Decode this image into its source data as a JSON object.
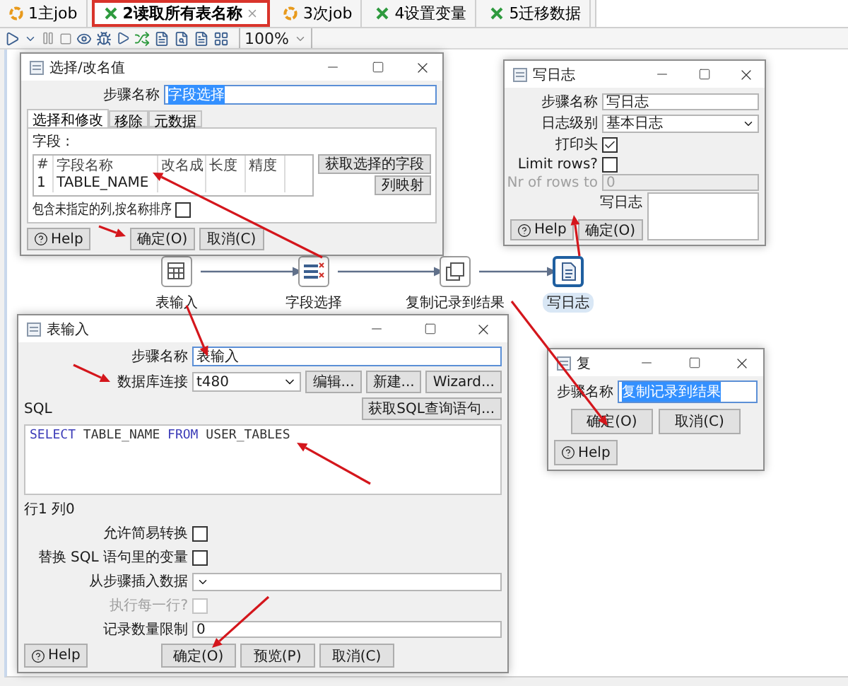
{
  "tabs": [
    {
      "label": "1主job",
      "kind": "job",
      "selected": false
    },
    {
      "label": "2读取所有表名称",
      "kind": "transformation",
      "selected": true
    },
    {
      "label": "3次job",
      "kind": "job",
      "selected": false
    },
    {
      "label": "4设置变量",
      "kind": "transformation",
      "selected": false
    },
    {
      "label": "5迁移数据",
      "kind": "transformation",
      "selected": false
    }
  ],
  "toolbar": {
    "zoom": "100%"
  },
  "select_dialog": {
    "title": "选择/改名值",
    "step_name_label": "步骤名称",
    "step_name": "字段选择",
    "tabs": [
      {
        "label": "选择和修改",
        "selected": true
      },
      {
        "label": "移除",
        "selected": false
      },
      {
        "label": "元数据",
        "selected": false
      }
    ],
    "fields_label": "字段 :",
    "columns": [
      "#",
      "字段名称",
      "改名成",
      "长度",
      "精度"
    ],
    "rows": [
      {
        "index": "1",
        "name": "TABLE_NAME"
      }
    ],
    "get_fields_button": "获取选择的字段",
    "mapping_button": "列映射",
    "include_unspecified": {
      "label": "包含未指定的列,按名称排序",
      "checked": false
    },
    "buttons": {
      "help": "Help",
      "ok": "确定(O)",
      "cancel": "取消(C)"
    }
  },
  "log_dialog": {
    "title": "写日志",
    "fields": [
      {
        "kind": "text",
        "label": "步骤名称",
        "value": "写日志",
        "disabled": false
      },
      {
        "kind": "select",
        "label": "日志级别",
        "value": "基本日志",
        "disabled": false
      },
      {
        "kind": "checkbox",
        "label": "打印头",
        "checked": true,
        "disabled": false
      },
      {
        "kind": "checkbox",
        "label": "Limit rows?",
        "checked": false,
        "disabled": false
      },
      {
        "kind": "text",
        "label": "Nr of rows to",
        "value": "0",
        "disabled": true
      },
      {
        "kind": "textarea",
        "label": "写日志",
        "disabled": false
      }
    ],
    "buttons": {
      "help": "Help",
      "ok": "确定(O)"
    }
  },
  "steps": [
    {
      "label": "表输入",
      "kind": "table-input",
      "selected": false
    },
    {
      "label": "字段选择",
      "kind": "select-values",
      "selected": false
    },
    {
      "label": "复制记录到结果",
      "kind": "copy-rows",
      "selected": false
    },
    {
      "label": "写日志",
      "kind": "write-log",
      "selected": true
    }
  ],
  "table_input_dialog": {
    "title": "表输入",
    "step_name_label": "步骤名称",
    "step_name": "表输入",
    "connection_label": "数据库连接",
    "connection": "t480",
    "connection_buttons": [
      "编辑...",
      "新建...",
      "Wizard..."
    ],
    "sql_label": "SQL",
    "get_sql_button": "获取SQL查询语句...",
    "sql": [
      {
        "text": "SELECT",
        "kind": "keyword"
      },
      {
        "text": " TABLE_NAME ",
        "kind": "plain"
      },
      {
        "text": "FROM",
        "kind": "keyword"
      },
      {
        "text": " USER_TABLES",
        "kind": "plain"
      }
    ],
    "cursor_position": "行1 列0",
    "options": [
      {
        "kind": "checkbox",
        "label": "允许简易转换",
        "checked": false,
        "disabled": false
      },
      {
        "kind": "checkbox",
        "label": "替换 SQL 语句里的变量",
        "checked": false,
        "disabled": false
      },
      {
        "kind": "select",
        "label": "从步骤插入数据",
        "disabled": false
      },
      {
        "kind": "checkbox",
        "label": "执行每一行?",
        "checked": false,
        "disabled": true
      },
      {
        "kind": "text",
        "label": "记录数量限制",
        "value": "0",
        "disabled": false
      }
    ],
    "buttons": {
      "help": "Help",
      "ok": "确定(O)",
      "preview": "预览(P)",
      "cancel": "取消(C)"
    }
  },
  "copy_dialog": {
    "title": "复",
    "step_name_label": "步骤名称",
    "step_name": "复制记录到结果",
    "buttons": {
      "ok": "确定(O)",
      "cancel": "取消(C)",
      "help": "Help"
    }
  }
}
